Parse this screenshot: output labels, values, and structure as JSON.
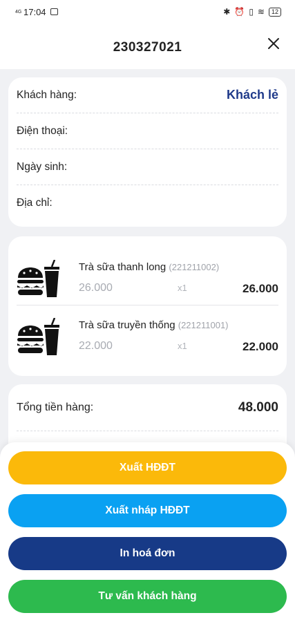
{
  "status_bar": {
    "signal": "4G",
    "time": "17:04",
    "battery": "12"
  },
  "header": {
    "order_code": "230327021"
  },
  "customer": {
    "fields": [
      {
        "label": "Khách hàng:",
        "value": "Khách lẻ"
      },
      {
        "label": "Điện thoại:",
        "value": ""
      },
      {
        "label": "Ngày sinh:",
        "value": ""
      },
      {
        "label": "Địa chỉ:",
        "value": ""
      }
    ]
  },
  "items": [
    {
      "name": "Trà sữa thanh long",
      "sku": "(221211002)",
      "price": "26.000",
      "qty": "x1",
      "total": "26.000",
      "icon": "burger-drink-icon"
    },
    {
      "name": "Trà sữa truyền thống",
      "sku": "(221211001)",
      "price": "22.000",
      "qty": "x1",
      "total": "22.000",
      "icon": "burger-drink-icon"
    }
  ],
  "summary": {
    "total_label": "Tổng tiền hàng:",
    "total_value": "48.000"
  },
  "actions": [
    {
      "label": "Xuất HĐĐT",
      "color": "#fbb90a"
    },
    {
      "label": "Xuất nháp HĐĐT",
      "color": "#0aa1f2"
    },
    {
      "label": "In hoá đơn",
      "color": "#173a87"
    },
    {
      "label": "Tư vấn khách hàng",
      "color": "#2dba4e"
    }
  ],
  "colors": {
    "customer_value": "#1f3a8a",
    "background": "#f0f1f4"
  }
}
